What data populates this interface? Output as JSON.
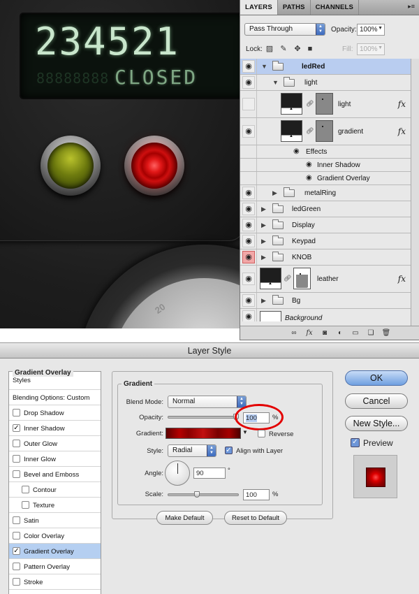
{
  "artwork": {
    "lcd_main": "234521",
    "lcd_ghost": "88888888",
    "lcd_sub": "CLOSED",
    "knob_mark": "20"
  },
  "layers_panel": {
    "tabs": [
      "LAYERS",
      "PATHS",
      "CHANNELS"
    ],
    "blend_mode": "Pass Through",
    "opacity_label": "Opacity:",
    "opacity_value": "100%",
    "lock_label": "Lock:",
    "fill_label": "Fill:",
    "fill_value": "100%",
    "layers": [
      {
        "name": "ledRed",
        "type": "group",
        "selected": true
      },
      {
        "name": "light",
        "type": "group"
      },
      {
        "name": "light",
        "type": "layer",
        "fx": "fx"
      },
      {
        "name": "gradient",
        "type": "layer",
        "fx": "fx"
      },
      {
        "name": "Effects",
        "type": "effects"
      },
      {
        "name": "Inner Shadow",
        "type": "effect"
      },
      {
        "name": "Gradient Overlay",
        "type": "effect"
      },
      {
        "name": "metalRing",
        "type": "group"
      },
      {
        "name": "ledGreen",
        "type": "group"
      },
      {
        "name": "Display",
        "type": "group"
      },
      {
        "name": "Keypad",
        "type": "group"
      },
      {
        "name": "KNOB",
        "type": "group"
      },
      {
        "name": "leather",
        "type": "layer",
        "fx": "fx"
      },
      {
        "name": "Bg",
        "type": "group"
      },
      {
        "name": "Background",
        "type": "layer"
      }
    ],
    "footer_icons": [
      "link-icon",
      "fx-icon",
      "mask-icon",
      "adjustment-icon",
      "group-icon",
      "new-layer-icon",
      "trash-icon"
    ]
  },
  "dialog": {
    "title": "Layer Style",
    "styles_header": "Styles",
    "blending_options": "Blending Options: Custom",
    "styles": [
      {
        "label": "Drop Shadow",
        "checked": false
      },
      {
        "label": "Inner Shadow",
        "checked": true
      },
      {
        "label": "Outer Glow",
        "checked": false
      },
      {
        "label": "Inner Glow",
        "checked": false
      },
      {
        "label": "Bevel and Emboss",
        "checked": false
      },
      {
        "label": "Contour",
        "checked": false,
        "sub": true
      },
      {
        "label": "Texture",
        "checked": false,
        "sub": true
      },
      {
        "label": "Satin",
        "checked": false
      },
      {
        "label": "Color Overlay",
        "checked": false
      },
      {
        "label": "Gradient Overlay",
        "checked": true,
        "selected": true
      },
      {
        "label": "Pattern Overlay",
        "checked": false
      },
      {
        "label": "Stroke",
        "checked": false
      }
    ],
    "panel_title": "Gradient Overlay",
    "group_title": "Gradient",
    "blend_mode_label": "Blend Mode:",
    "blend_mode_value": "Normal",
    "opacity_label": "Opacity:",
    "opacity_value": "100",
    "opacity_unit": "%",
    "opacity_fraction": 1.0,
    "gradient_label": "Gradient:",
    "reverse_label": "Reverse",
    "style_label": "Style:",
    "style_value": "Radial",
    "align_label": "Align with Layer",
    "angle_label": "Angle:",
    "angle_value": "90",
    "angle_unit": "°",
    "scale_label": "Scale:",
    "scale_value": "100",
    "scale_unit": "%",
    "scale_fraction": 0.4,
    "make_default": "Make Default",
    "reset_default": "Reset to Default",
    "ok": "OK",
    "cancel": "Cancel",
    "new_style": "New Style...",
    "preview": "Preview"
  },
  "colors": {
    "selection": "#b9cdf0",
    "highlight_ring": "#e30000",
    "led_red": "#d01010",
    "led_green": "#8a9a12"
  }
}
